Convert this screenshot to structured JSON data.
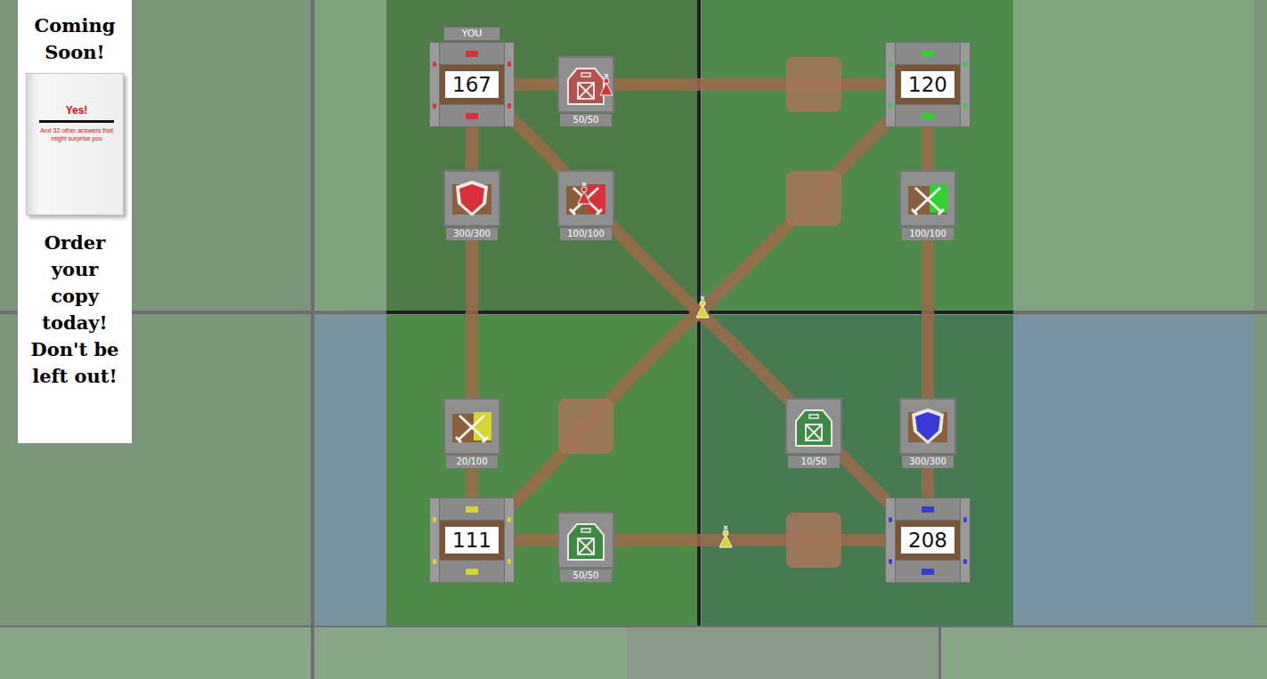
{
  "ad": {
    "heading": "Coming Soon!",
    "book_title": "Yes!",
    "book_subtitle": "And 32 other answers that might surprise you",
    "cta": "Order your copy today! Don't be left out!"
  },
  "you_label": "YOU",
  "bases": [
    {
      "count": "167",
      "color": "#d9303a",
      "you": true
    },
    {
      "count": "120",
      "color": "#2fd12f",
      "you": false
    },
    {
      "count": "111",
      "color": "#d6d631",
      "you": false
    },
    {
      "count": "208",
      "color": "#3a3ad6",
      "you": false
    }
  ],
  "buildings": [
    {
      "kind": "barn",
      "hp": "50/50",
      "color": "#b3524f"
    },
    {
      "kind": "barracks",
      "hp": "100/100",
      "color": "#d9303a"
    },
    {
      "kind": "shield",
      "hp": "300/300",
      "color": "#d9303a"
    },
    {
      "kind": "barracks",
      "hp": "100/100",
      "color": "#2fd12f"
    },
    {
      "kind": "barracks",
      "hp": "20/100",
      "color": "#d6d631"
    },
    {
      "kind": "barn",
      "hp": "50/50",
      "color": "#3d8a45"
    },
    {
      "kind": "barn",
      "hp": "10/50",
      "color": "#3d8a45"
    },
    {
      "kind": "shield",
      "hp": "300/300",
      "color": "#3a3ad6"
    }
  ],
  "plots": [
    {
      "empty": true
    },
    {
      "empty": true
    },
    {
      "empty": true
    },
    {
      "empty": true
    }
  ],
  "units": [
    {
      "color": "#d9303a"
    },
    {
      "color": "#d9303a"
    },
    {
      "color": "#d6d631"
    },
    {
      "color": "#d6d631"
    }
  ]
}
